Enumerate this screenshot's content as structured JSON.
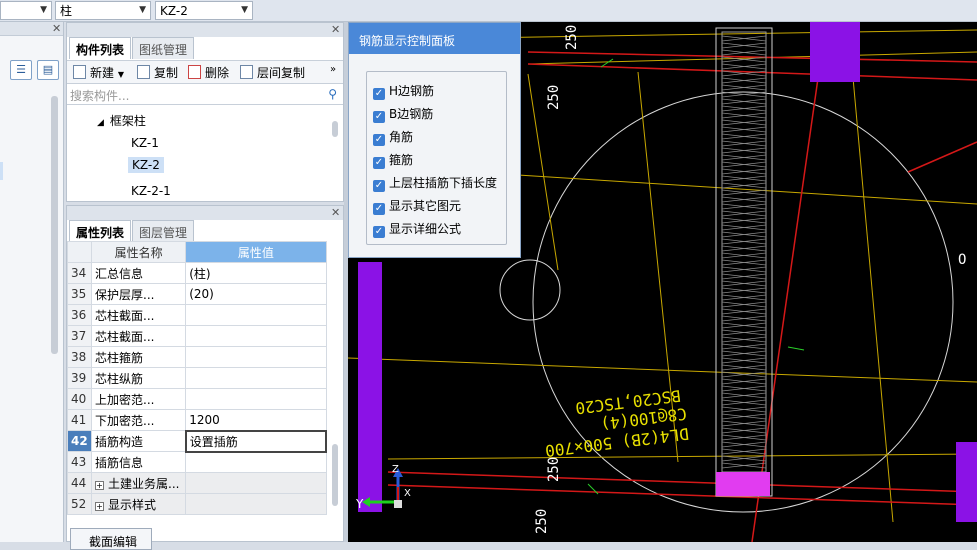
{
  "topbar": {
    "combo1": "",
    "combo2": "柱",
    "combo3": "KZ-2"
  },
  "component_panel": {
    "tabs": [
      "构件列表",
      "图纸管理"
    ],
    "toolbar": {
      "new": "新建",
      "copy": "复制",
      "delete": "删除",
      "floor_copy": "层间复制",
      "more": "»"
    },
    "search_placeholder": "搜索构件...",
    "tree": {
      "group": "框架柱",
      "items": [
        "KZ-1",
        "KZ-2",
        "KZ-2-1"
      ],
      "selected": "KZ-2"
    }
  },
  "property_panel": {
    "tabs": [
      "属性列表",
      "图层管理"
    ],
    "columns": {
      "name": "属性名称",
      "value": "属性值"
    },
    "rows": [
      {
        "num": "34",
        "name": "汇总信息",
        "value": "(柱)"
      },
      {
        "num": "35",
        "name": "保护层厚...",
        "value": "(20)"
      },
      {
        "num": "36",
        "name": "芯柱截面...",
        "value": ""
      },
      {
        "num": "37",
        "name": "芯柱截面...",
        "value": ""
      },
      {
        "num": "38",
        "name": "芯柱箍筋",
        "value": ""
      },
      {
        "num": "39",
        "name": "芯柱纵筋",
        "value": ""
      },
      {
        "num": "40",
        "name": "上加密范...",
        "value": ""
      },
      {
        "num": "41",
        "name": "下加密范...",
        "value": "1200"
      },
      {
        "num": "42",
        "name": "插筋构造",
        "value": "设置插筋"
      },
      {
        "num": "43",
        "name": "插筋信息",
        "value": ""
      },
      {
        "num": "44",
        "name": "土建业务属...",
        "value": ""
      },
      {
        "num": "52",
        "name": "显示样式",
        "value": ""
      }
    ],
    "section_edit": "截面编辑"
  },
  "rebar_dialog": {
    "title": "钢筋显示控制面板",
    "options": [
      "H边钢筋",
      "B边钢筋",
      "角筋",
      "箍筋",
      "上层柱插筋下插长度",
      "显示其它图元",
      "显示详细公式"
    ]
  },
  "viewport": {
    "dims": [
      "250",
      "250",
      "250",
      "250"
    ],
    "annotations": [
      "BSC20,TSC20",
      "C8@100(4)",
      "DL4(2B) 500×700"
    ],
    "axis": {
      "x": "X",
      "y": "Y",
      "z": "Z"
    },
    "edge_text": "O",
    "colors": {
      "grid_line": "#c8a800",
      "red_line": "#d41818",
      "column_fill": "#8b12e6",
      "magenta": "#e13cf0",
      "dim_text": "#ffffff",
      "annotation_text": "#e8e000",
      "dim_line": "#2ad12a"
    }
  }
}
